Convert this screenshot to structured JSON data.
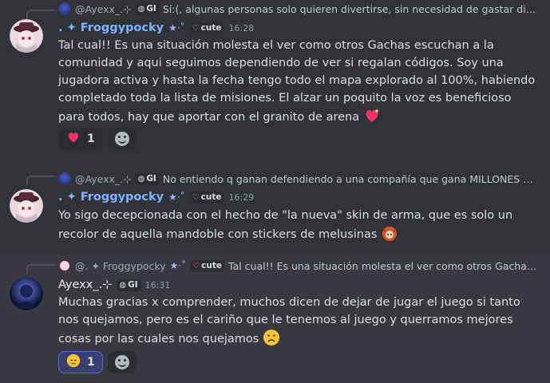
{
  "messages": [
    {
      "reply": {
        "author": "@Ayexx_.⊹",
        "tag": "GI",
        "text": "Sí:(, algunas personas solo quieren divertirse, sin necesidad de gastar diner…"
      },
      "author": ". ✦ Froggypocky",
      "author_deco": "★·˚",
      "tag": "cute",
      "time": "16:28",
      "text": "Tal cual!! Es una situación molesta el ver como otros Gachas escuchan a la comunidad y aqui seguimos dependiendo de ver si regalan códigos. Soy una jugadora activa y hasta la fecha tengo todo el mapa explorado al 100%, habiendo completado toda la lista de misiones. El alzar un poquito la voz es beneficioso para todos, hay que aportar con el granito de arena",
      "reaction": {
        "emoji": "heart-icon",
        "count": "1"
      }
    },
    {
      "reply": {
        "author": "@Ayexx_.⊹",
        "tag": "GI",
        "text": "No entiendo q ganan defendiendo a una compañía que gana MILLONES y n…"
      },
      "author": ". ✦ Froggypocky",
      "author_deco": "★·˚",
      "tag": "cute",
      "time": "16:29",
      "text": "Yo sigo decepcionada con el hecho de \"la nueva\" skin de arma, que es solo un recolor de aquella mandoble con stickers de melusinas"
    },
    {
      "reply": {
        "author": "@. ✦ Froggypocky",
        "author_deco": "★·˚",
        "tag": "cute",
        "text": "Tal cual!! Es una situación molesta el ver como otros Gachas e…"
      },
      "author": "Ayexx_.⊹",
      "tag": "GI",
      "time": "16:31",
      "text": "Muchas gracias x comprender,  muchos dicen de dejar de jugar el juego si tanto nos quejamos, pero es el cariño que le tenemos al juego y querramos mejores cosas por las cuales nos quejamos",
      "reaction": {
        "emoji": "sleepy-face-icon",
        "count": "1"
      }
    }
  ]
}
